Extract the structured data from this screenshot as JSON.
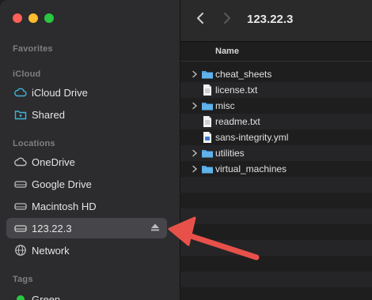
{
  "window": {
    "title": "123.22.3"
  },
  "sidebar": {
    "sections": {
      "favorites": "Favorites",
      "icloud": "iCloud",
      "locations": "Locations",
      "tags": "Tags"
    },
    "icloud_items": [
      {
        "label": "iCloud Drive",
        "icon": "cloud-icon"
      },
      {
        "label": "Shared",
        "icon": "shared-folder-icon"
      }
    ],
    "location_items": [
      {
        "label": "OneDrive",
        "icon": "cloud-icon"
      },
      {
        "label": "Google Drive",
        "icon": "drive-icon"
      },
      {
        "label": "Macintosh HD",
        "icon": "drive-icon"
      },
      {
        "label": "123.22.3",
        "icon": "drive-icon",
        "selected": true,
        "ejectable": true
      },
      {
        "label": "Network",
        "icon": "network-icon"
      }
    ],
    "tag_items": [
      {
        "label": "Green",
        "color": "#28c840"
      }
    ]
  },
  "toolbar": {
    "back": "back-chevron-icon",
    "forward": "forward-chevron-icon",
    "title": "123.22.3"
  },
  "filelist": {
    "column_name": "Name",
    "rows": [
      {
        "name": "cheat_sheets",
        "type": "folder",
        "expandable": true
      },
      {
        "name": "license.txt",
        "type": "file",
        "expandable": false
      },
      {
        "name": "misc",
        "type": "folder",
        "expandable": true
      },
      {
        "name": "readme.txt",
        "type": "file",
        "expandable": false
      },
      {
        "name": "sans-integrity.yml",
        "type": "yml",
        "expandable": false
      },
      {
        "name": "utilities",
        "type": "folder",
        "expandable": true
      },
      {
        "name": "virtual_machines",
        "type": "folder",
        "expandable": true
      }
    ]
  },
  "colors": {
    "accent_arrow": "#e8514a",
    "folder_blue": "#4fa3e0",
    "sidebar_bg": "#2c2b2e"
  }
}
